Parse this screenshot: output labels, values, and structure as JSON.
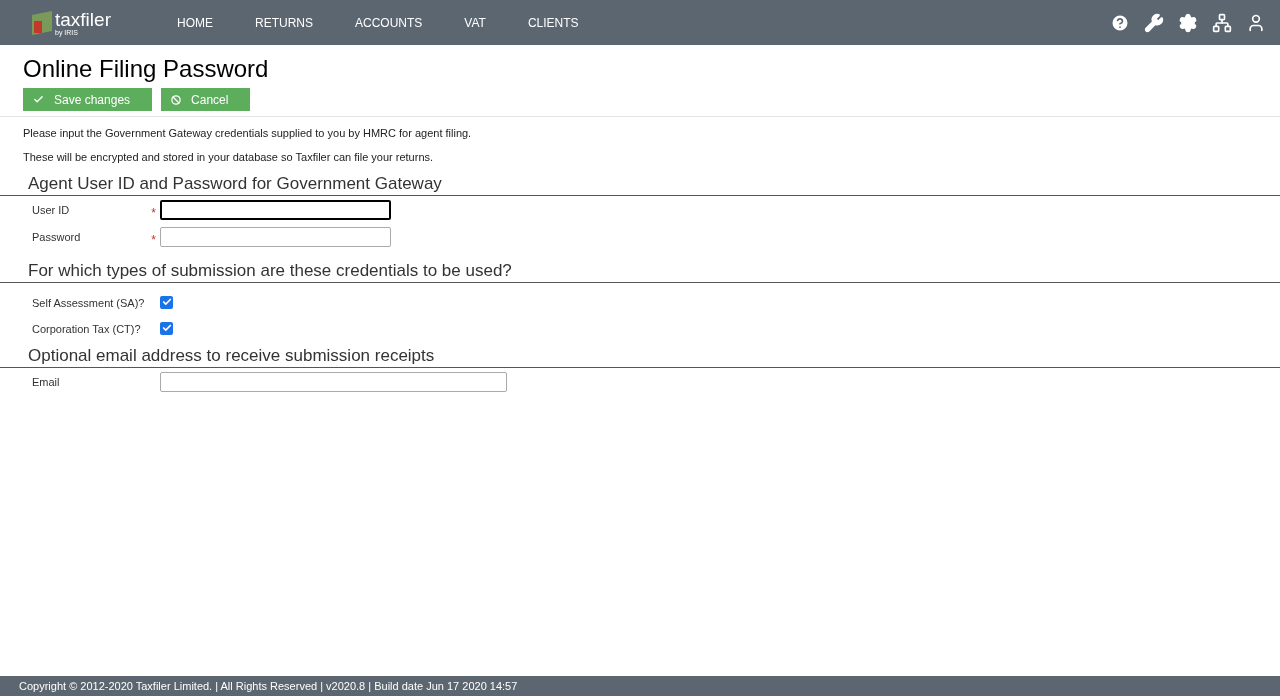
{
  "brand": {
    "name": "taxfiler",
    "sub": "by IRIS"
  },
  "nav": [
    {
      "label": "HOME"
    },
    {
      "label": "RETURNS"
    },
    {
      "label": "ACCOUNTS"
    },
    {
      "label": "VAT"
    },
    {
      "label": "CLIENTS"
    }
  ],
  "page_title": "Online Filing Password",
  "actions": [
    {
      "label": "Save changes",
      "kind": "save"
    },
    {
      "label": "Cancel",
      "kind": "cancel"
    }
  ],
  "intro": [
    "Please input the Government Gateway credentials supplied to you by HMRC for agent filing.",
    "These will be encrypted and stored in your database so Taxfiler can file your returns."
  ],
  "sections": [
    {
      "heading": "Agent User ID and Password for Government Gateway",
      "fields": [
        {
          "kind": "text",
          "label": "User ID",
          "required_mark": "*",
          "focused": true
        },
        {
          "kind": "text",
          "label": "Password",
          "required_mark": "*",
          "focused": false
        }
      ]
    },
    {
      "heading": "For which types of submission are these credentials to be used?",
      "fields": [
        {
          "kind": "checkbox",
          "label": "Self Assessment (SA)?",
          "checked": true
        },
        {
          "kind": "checkbox",
          "label": "Corporation Tax (CT)?",
          "checked": true
        }
      ]
    },
    {
      "heading": "Optional email address to receive submission receipts",
      "fields": [
        {
          "kind": "wide",
          "label": "Email",
          "focused": false
        }
      ]
    }
  ],
  "footer": "Copyright © 2012-2020 Taxfiler Limited. | All Rights Reserved | v2020.8 | Build date Jun 17 2020 14:57"
}
